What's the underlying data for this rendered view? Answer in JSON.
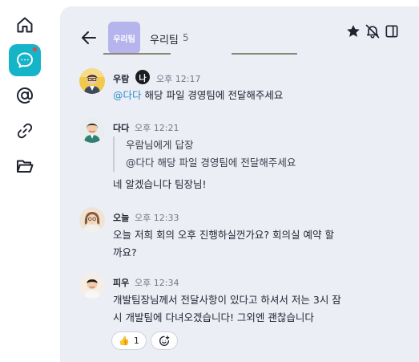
{
  "rail": {
    "icons": [
      "home-icon",
      "chat-icon",
      "mention-icon",
      "link-icon",
      "folder-icon"
    ],
    "active_color": "#16b4c9",
    "badge_color": "#ff3b3b"
  },
  "room": {
    "logo_text": "우리팀",
    "name": "우리팀",
    "member_count": "5",
    "logo_color": "#b5b4ec"
  },
  "header_actions": [
    "star-icon",
    "bell-off-icon",
    "sidebar-toggle-icon"
  ],
  "messages": [
    {
      "author": "우람",
      "role_badge": "나",
      "time": "오후 12:17",
      "mention": "@다다",
      "text": " 해당 파일 경영팀에 전달해주세요"
    },
    {
      "author": "다다",
      "time": "오후 12:21",
      "quote_title": "우람님에게 답장",
      "quote_text": "@다다 해당 파일 경영팀에 전달해주세요",
      "text": "네 알겠습니다 팀장님!"
    },
    {
      "author": "오늘",
      "time": "오후 12:33",
      "text_line1": "오늘 저희 회의 오후 진행하실껀가요? 회의실 예약 할",
      "text_line2": "까요?"
    },
    {
      "author": "피우",
      "time": "오후 12:34",
      "text_line1": "개발팀장님께서 전달사항이 있다고 하셔서 저는 3시 잠",
      "text_line2": "시 개발팀에 다녀오겠습니다! 그외엔 괜찮습니다",
      "reaction_emoji": "👍",
      "reaction_count": "1",
      "add_reaction_icon": "add-emoji-icon"
    }
  ]
}
